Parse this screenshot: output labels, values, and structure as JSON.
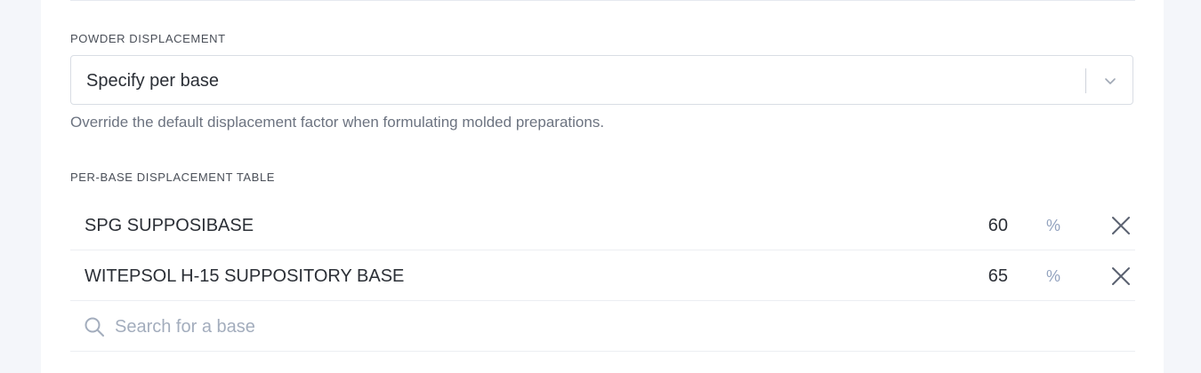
{
  "powder_displacement": {
    "label": "POWDER DISPLACEMENT",
    "selected_value": "Specify per base",
    "help_text": "Override the default displacement factor when formulating molded preparations."
  },
  "per_base_table": {
    "label": "PER-BASE DISPLACEMENT TABLE",
    "rows": [
      {
        "name": "SPG SUPPOSIBASE",
        "value": "60",
        "unit": "%"
      },
      {
        "name": "WITEPSOL H-15 SUPPOSITORY BASE",
        "value": "65",
        "unit": "%"
      }
    ],
    "search_placeholder": "Search for a base"
  },
  "icons": {
    "dropdown": "chevron-down-icon",
    "remove": "close-icon",
    "search": "search-icon"
  },
  "colors": {
    "unit_text": "#93a3bf",
    "placeholder_text": "#a3adbd",
    "border": "#d9dde4",
    "page_background": "#f4f6fa"
  }
}
